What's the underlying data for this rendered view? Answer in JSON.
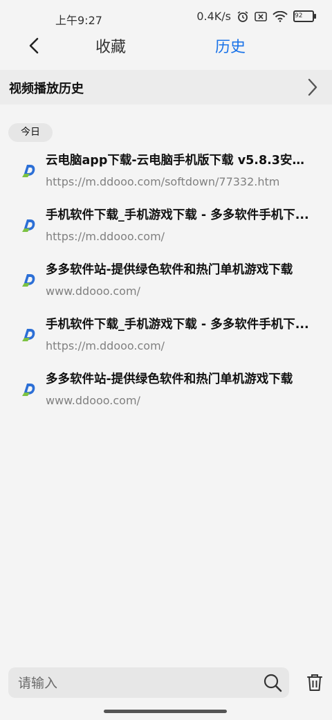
{
  "status_bar": {
    "time": "上午9:27",
    "network_speed": "0.4K/s",
    "battery": "92"
  },
  "header": {
    "tabs": [
      {
        "label": "收藏",
        "active": false
      },
      {
        "label": "历史",
        "active": true
      }
    ],
    "active_color": "#1a73e8"
  },
  "video_history": {
    "label": "视频播放历史"
  },
  "date_group": "今日",
  "history_items": [
    {
      "title": "云电脑app下载-云电脑手机版下载 v5.8.3安卓...",
      "url": "https://m.ddooo.com/softdown/77332.htm"
    },
    {
      "title": "手机软件下载_手机游戏下载 - 多多软件手机下...",
      "url": "https://m.ddooo.com/"
    },
    {
      "title": "多多软件站-提供绿色软件和热门单机游戏下载",
      "url": "www.ddooo.com/"
    },
    {
      "title": "手机软件下载_手机游戏下载 - 多多软件手机下...",
      "url": "https://m.ddooo.com/"
    },
    {
      "title": "多多软件站-提供绿色软件和热门单机游戏下载",
      "url": "www.ddooo.com/"
    }
  ],
  "search": {
    "placeholder": "请输入"
  }
}
